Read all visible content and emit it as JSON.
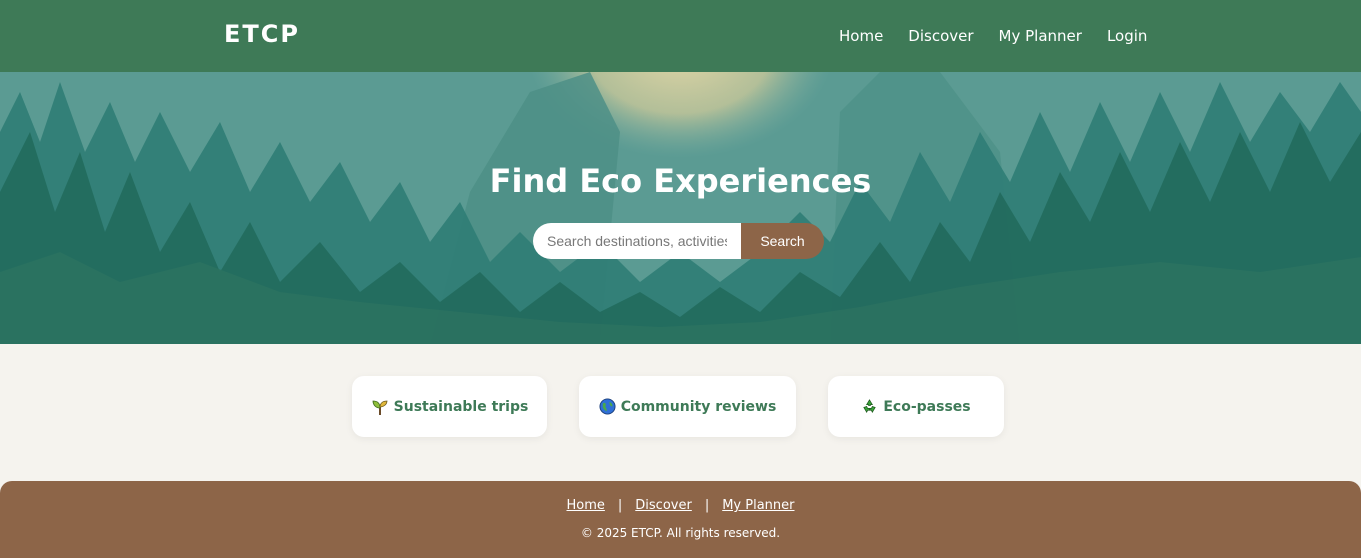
{
  "header": {
    "brand": "ETCP",
    "nav": [
      "Home",
      "Discover",
      "My Planner",
      "Login"
    ]
  },
  "hero": {
    "title": "Find Eco Experiences",
    "search_placeholder": "Search destinations, activities",
    "search_button": "Search"
  },
  "features": [
    {
      "icon": "seedling-icon",
      "label": "Sustainable trips"
    },
    {
      "icon": "globe-icon",
      "label": "Community reviews"
    },
    {
      "icon": "recycle-icon",
      "label": "Eco-passes"
    }
  ],
  "footer": {
    "links": [
      "Home",
      "Discover",
      "My Planner"
    ],
    "separator": "|",
    "copyright": "© 2025 ETCP. All rights reserved."
  },
  "colors": {
    "header_bg": "#3e7a57",
    "accent_brown": "#8d6548",
    "page_bg": "#f5f3ee"
  }
}
